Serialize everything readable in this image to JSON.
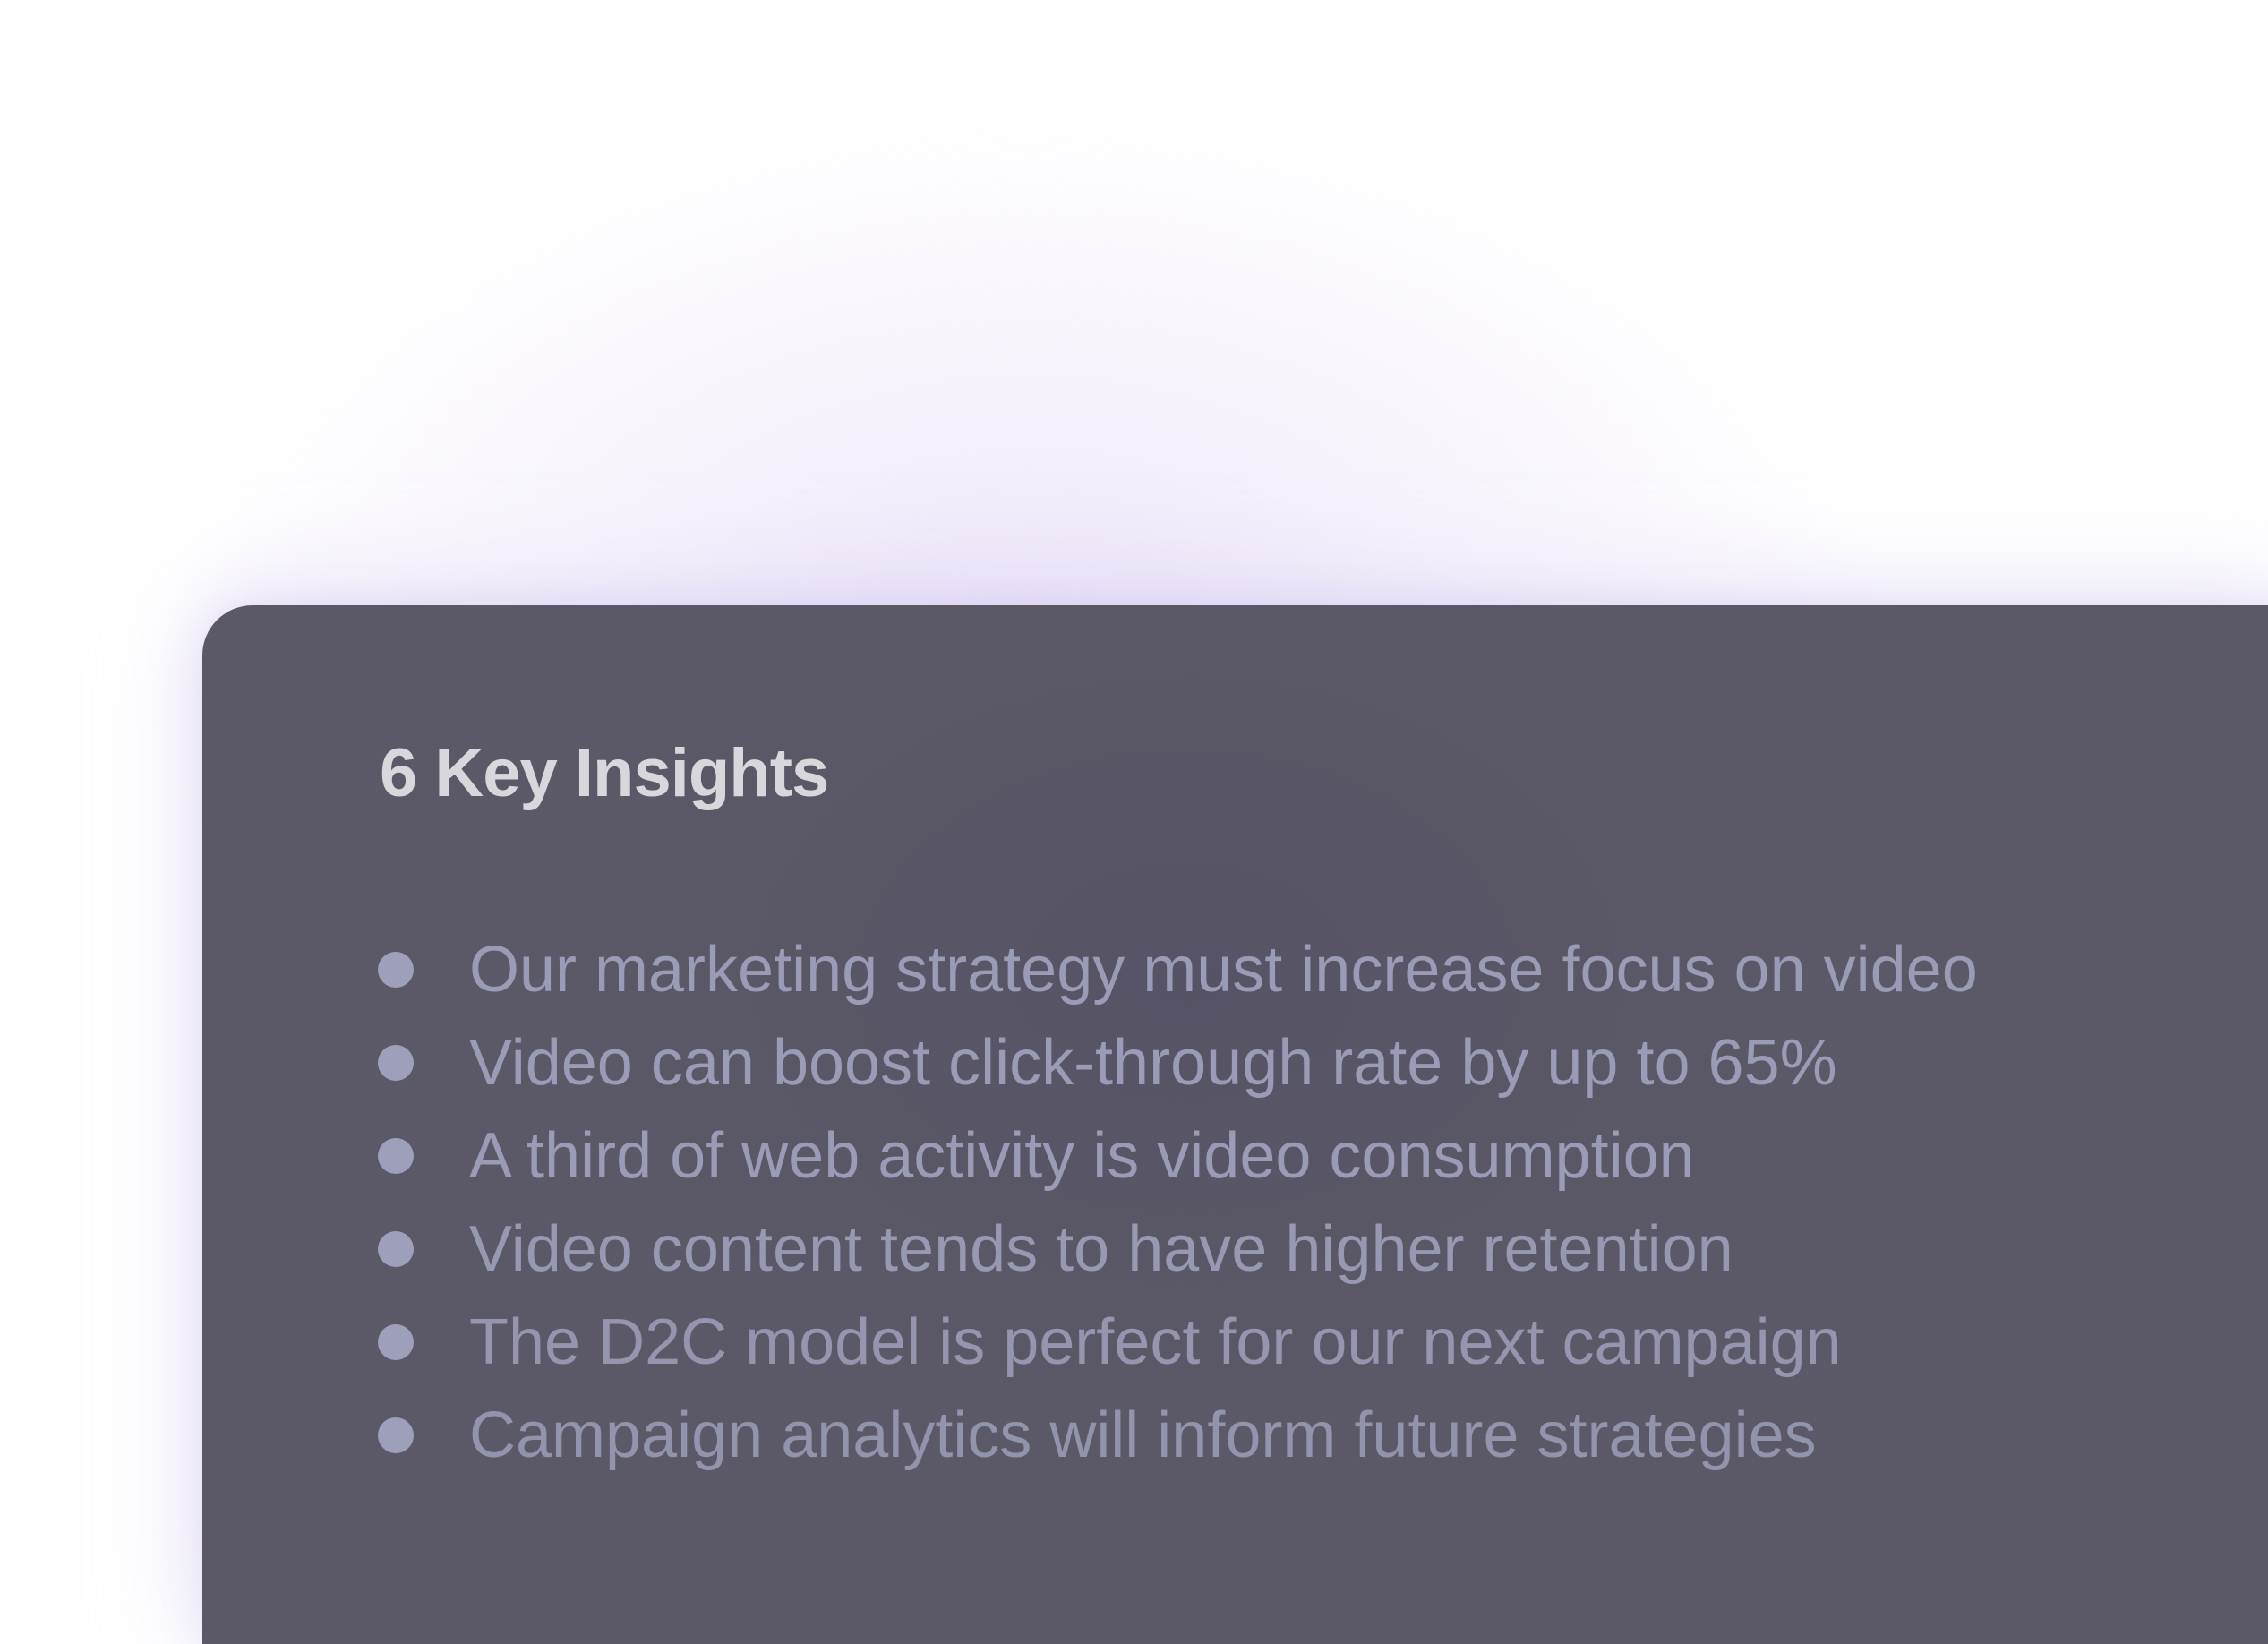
{
  "card": {
    "title": "6 Key Insights",
    "insights": [
      "Our marketing strategy must increase focus on video",
      "Video can boost click-through rate by up to 65%",
      "A third of web activity is video consumption",
      "Video content tends to have higher retention",
      "The D2C model is perfect for our next campaign",
      "Campaign analytics will inform future strategies"
    ]
  },
  "colors": {
    "card_background": "#5b5967",
    "title_text": "#d8d7dc",
    "list_text": "#9a9bb6",
    "bullet": "#9ea0bb",
    "page_glow": "#e6daf6"
  },
  "icons": {
    "bullet": "filled-circle"
  }
}
